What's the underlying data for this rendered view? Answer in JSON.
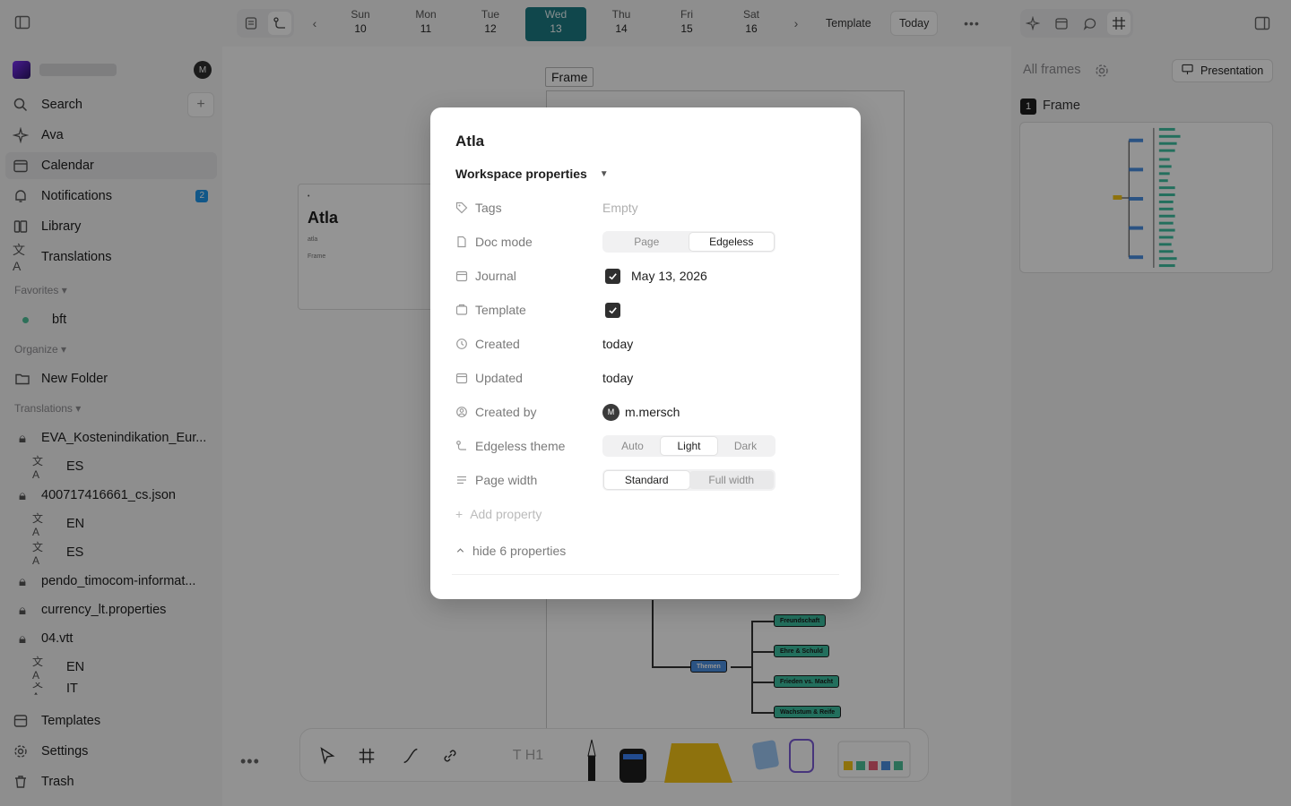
{
  "sidebar": {
    "nav": [
      {
        "label": "Search",
        "icon": "search-icon"
      },
      {
        "label": "Ava",
        "icon": "sparkle-icon"
      },
      {
        "label": "Calendar",
        "icon": "calendar-icon"
      },
      {
        "label": "Notifications",
        "icon": "bell-icon",
        "badge": "2"
      },
      {
        "label": "Library",
        "icon": "library-icon"
      },
      {
        "label": "Translations",
        "icon": "translate-icon"
      }
    ],
    "avatar_initial": "M",
    "favorites_heading": "Favorites",
    "favorites": [
      {
        "label": "bft"
      }
    ],
    "organize_heading": "Organize",
    "organize": [
      {
        "label": "New Folder"
      }
    ],
    "translations_heading": "Translations",
    "translations": [
      {
        "label": "EVA_Kostenindikation_Eur...",
        "sub": [
          "ES"
        ]
      },
      {
        "label": "400717416661_cs.json",
        "sub": [
          "EN",
          "ES"
        ]
      },
      {
        "label": "pendo_timocom-informat...",
        "sub": []
      },
      {
        "label": "currency_lt.properties",
        "sub": []
      },
      {
        "label": "04.vtt",
        "sub": [
          "EN",
          "IT"
        ]
      }
    ],
    "bottom": [
      {
        "label": "Templates",
        "icon": "templates-icon"
      },
      {
        "label": "Settings",
        "icon": "gear-icon"
      },
      {
        "label": "Trash",
        "icon": "trash-icon"
      }
    ]
  },
  "topbar": {
    "days": [
      {
        "name": "Sun",
        "num": "10"
      },
      {
        "name": "Mon",
        "num": "11"
      },
      {
        "name": "Tue",
        "num": "12"
      },
      {
        "name": "Wed",
        "num": "13",
        "today": true
      },
      {
        "name": "Thu",
        "num": "14"
      },
      {
        "name": "Fri",
        "num": "15"
      },
      {
        "name": "Sat",
        "num": "16"
      }
    ],
    "template_label": "Template",
    "today_label": "Today"
  },
  "canvas": {
    "frame_label": "Frame",
    "card_title": "Atla",
    "card_sub": "atla",
    "card_frame": "Frame",
    "mindmap": {
      "root": "Themen",
      "children": [
        "Freundschaft",
        "Ehre & Schuld",
        "Frieden vs. Macht",
        "Wachstum & Reife"
      ]
    }
  },
  "right_panel": {
    "all_frames": "All frames",
    "presentation_label": "Presentation",
    "frame_number": "1",
    "frame_name": "Frame"
  },
  "modal": {
    "title": "Atla",
    "section": "Workspace properties",
    "properties": {
      "tags": {
        "label": "Tags",
        "value": "Empty"
      },
      "doc_mode": {
        "label": "Doc mode",
        "options": [
          "Page",
          "Edgeless"
        ],
        "selected": "Edgeless"
      },
      "journal": {
        "label": "Journal",
        "checked": true,
        "value": "May 13, 2026"
      },
      "template": {
        "label": "Template",
        "checked": true
      },
      "created": {
        "label": "Created",
        "value": "today"
      },
      "updated": {
        "label": "Updated",
        "value": "today"
      },
      "created_by": {
        "label": "Created by",
        "avatar": "M",
        "value": "m.mersch"
      },
      "edgeless_theme": {
        "label": "Edgeless theme",
        "options": [
          "Auto",
          "Light",
          "Dark"
        ],
        "selected": "Light"
      },
      "page_width": {
        "label": "Page width",
        "options": [
          "Standard",
          "Full width"
        ],
        "selected": "Standard"
      }
    },
    "add_property": "Add property",
    "hide_properties": "hide 6 properties"
  },
  "colors": {
    "accent_today": "#1d7a84",
    "badge": "#1e96eb",
    "mindmap_green": "#3dbfa0",
    "mindmap_blue": "#4a90e2"
  }
}
